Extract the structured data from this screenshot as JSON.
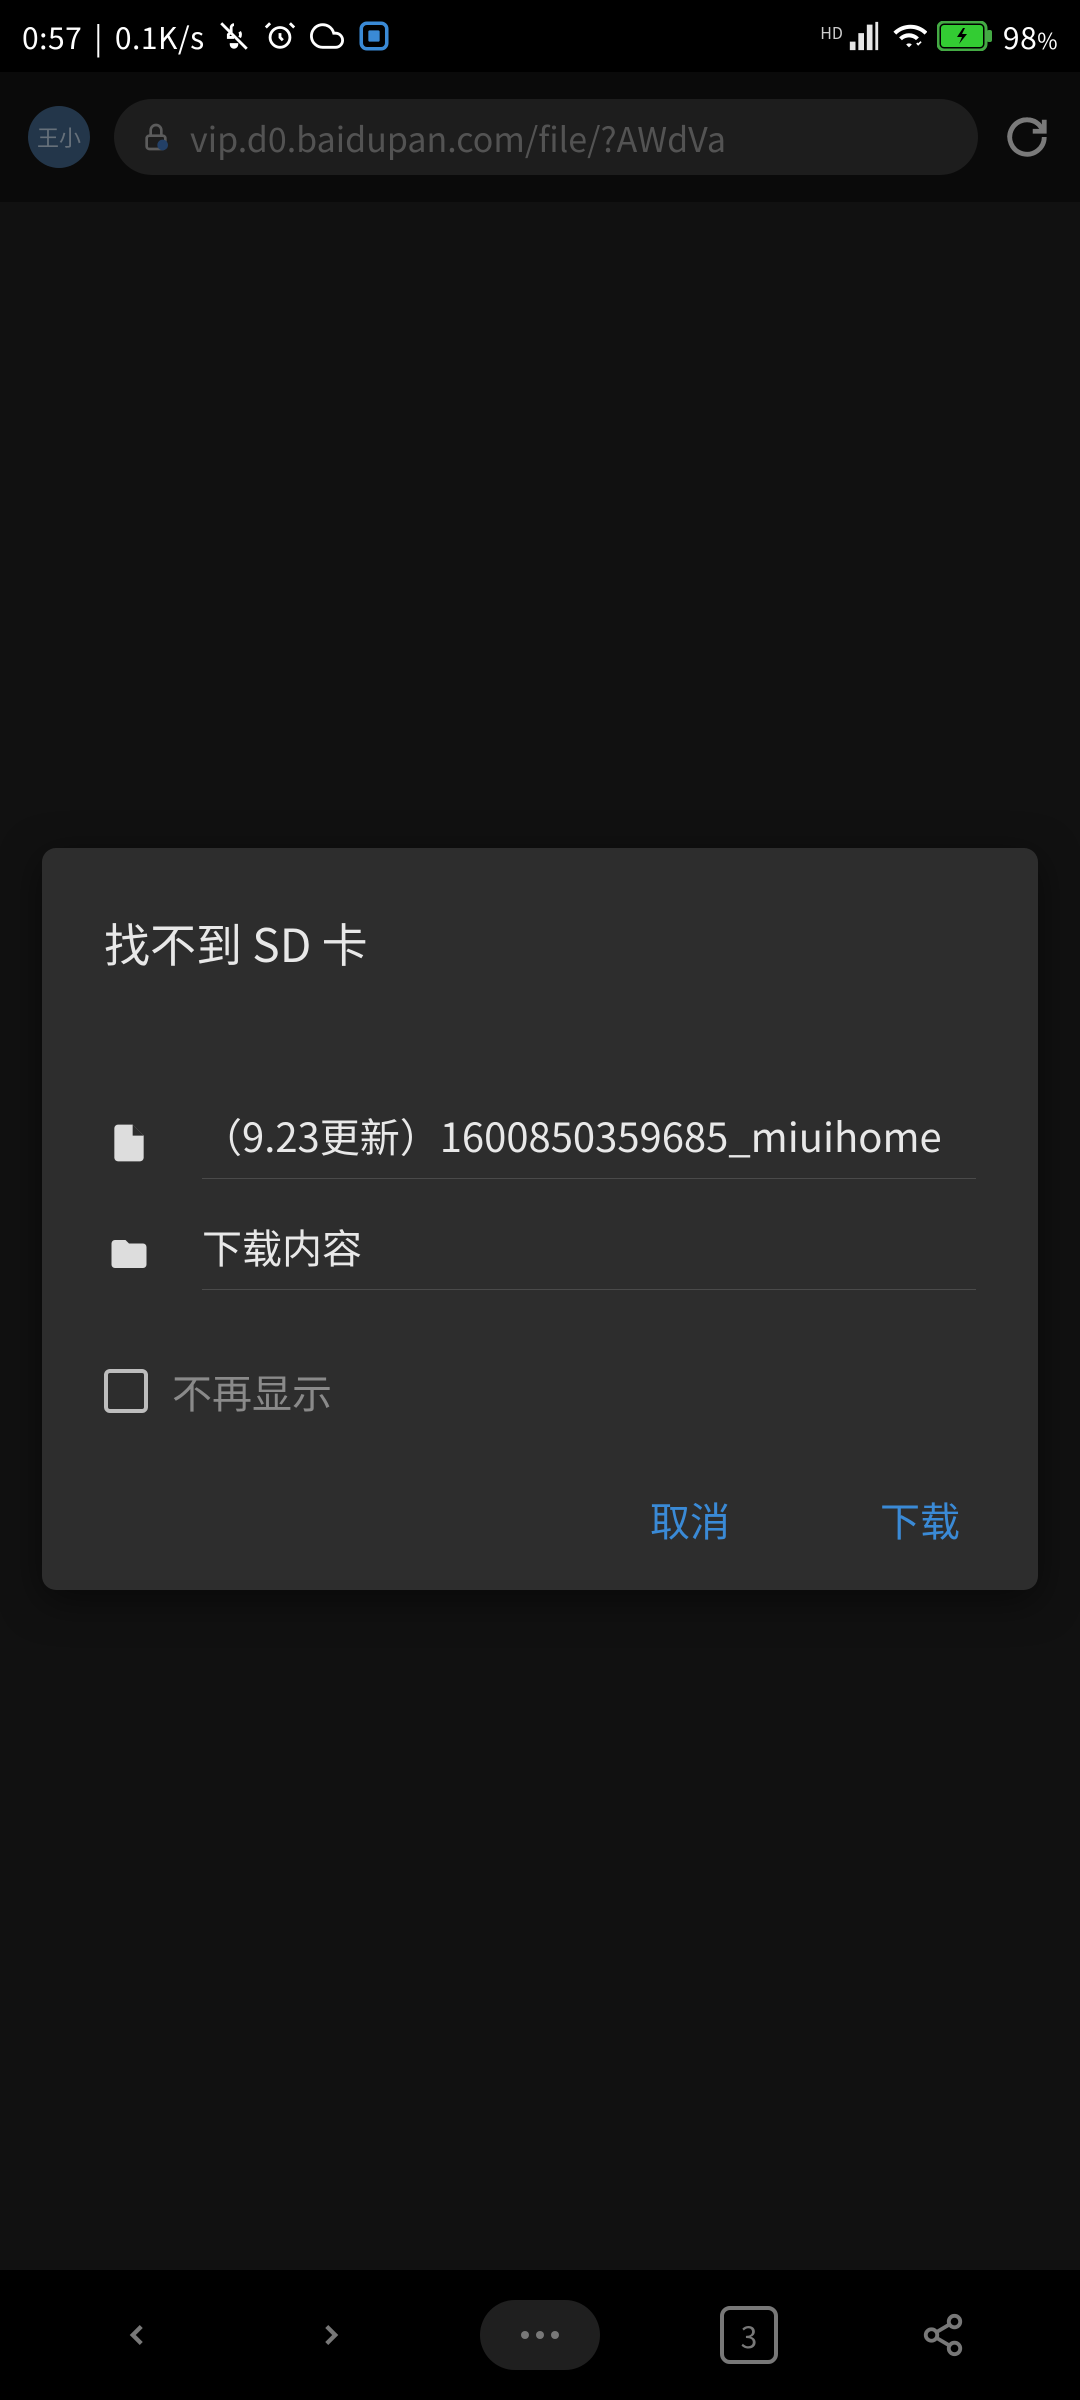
{
  "status": {
    "time": "0:57",
    "net_speed": "0.1K/s",
    "battery_pct": "98",
    "battery_suffix": "%",
    "hd_label": "HD"
  },
  "chrome": {
    "avatar_text": "王小",
    "url": "vip.d0.baidupan.com/file/?AWdVa"
  },
  "dialog": {
    "title": "找不到 SD 卡",
    "file_name": "（9.23更新）1600850359685_miuihome",
    "folder_name": "下载内容",
    "checkbox_label": "不再显示",
    "cancel_label": "取消",
    "download_label": "下载"
  },
  "nav": {
    "tab_count": "3"
  },
  "colors": {
    "accent": "#3a8ad6",
    "dialog_bg": "#2d2d2d"
  }
}
